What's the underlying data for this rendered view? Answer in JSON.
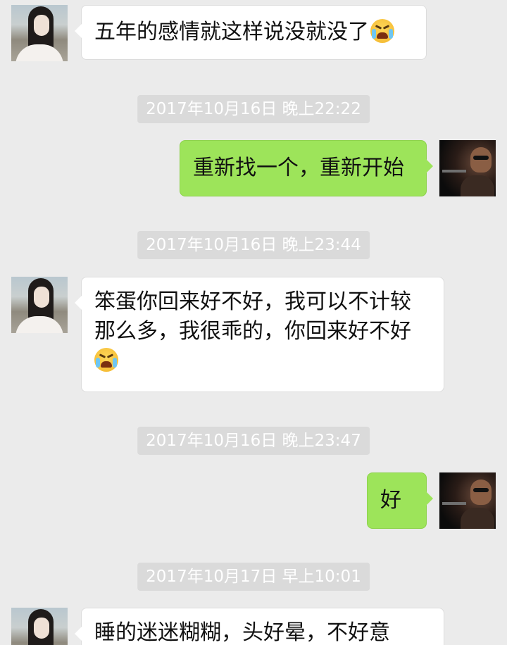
{
  "conversation": {
    "messages": [
      {
        "sender": "contact",
        "avatar": "girl-portrait",
        "text": "五年的感情就这样说没就没了",
        "emoji": "crying-face"
      },
      {
        "type": "timestamp",
        "text": "2017年10月16日 晚上22:22"
      },
      {
        "sender": "me",
        "avatar": "movie-poster",
        "text": "重新找一个，重新开始"
      },
      {
        "type": "timestamp",
        "text": "2017年10月16日 晚上23:44"
      },
      {
        "sender": "contact",
        "avatar": "girl-portrait",
        "line1": "笨蛋你回来好不好，我可以不计较",
        "line2": "那么多，我很乖的，你回来好不好",
        "emoji": "crying-face"
      },
      {
        "type": "timestamp",
        "text": "2017年10月16日 晚上23:47"
      },
      {
        "sender": "me",
        "avatar": "movie-poster",
        "text": "好"
      },
      {
        "type": "timestamp",
        "text": "2017年10月17日 早上10:01"
      },
      {
        "sender": "contact",
        "avatar": "girl-portrait",
        "text": "睡的迷迷糊糊，头好晕，不好意"
      }
    ]
  },
  "colors": {
    "background": "#ebebeb",
    "bubble_in": "#ffffff",
    "bubble_out": "#9de45a",
    "timestamp_bg": "#dadada"
  }
}
